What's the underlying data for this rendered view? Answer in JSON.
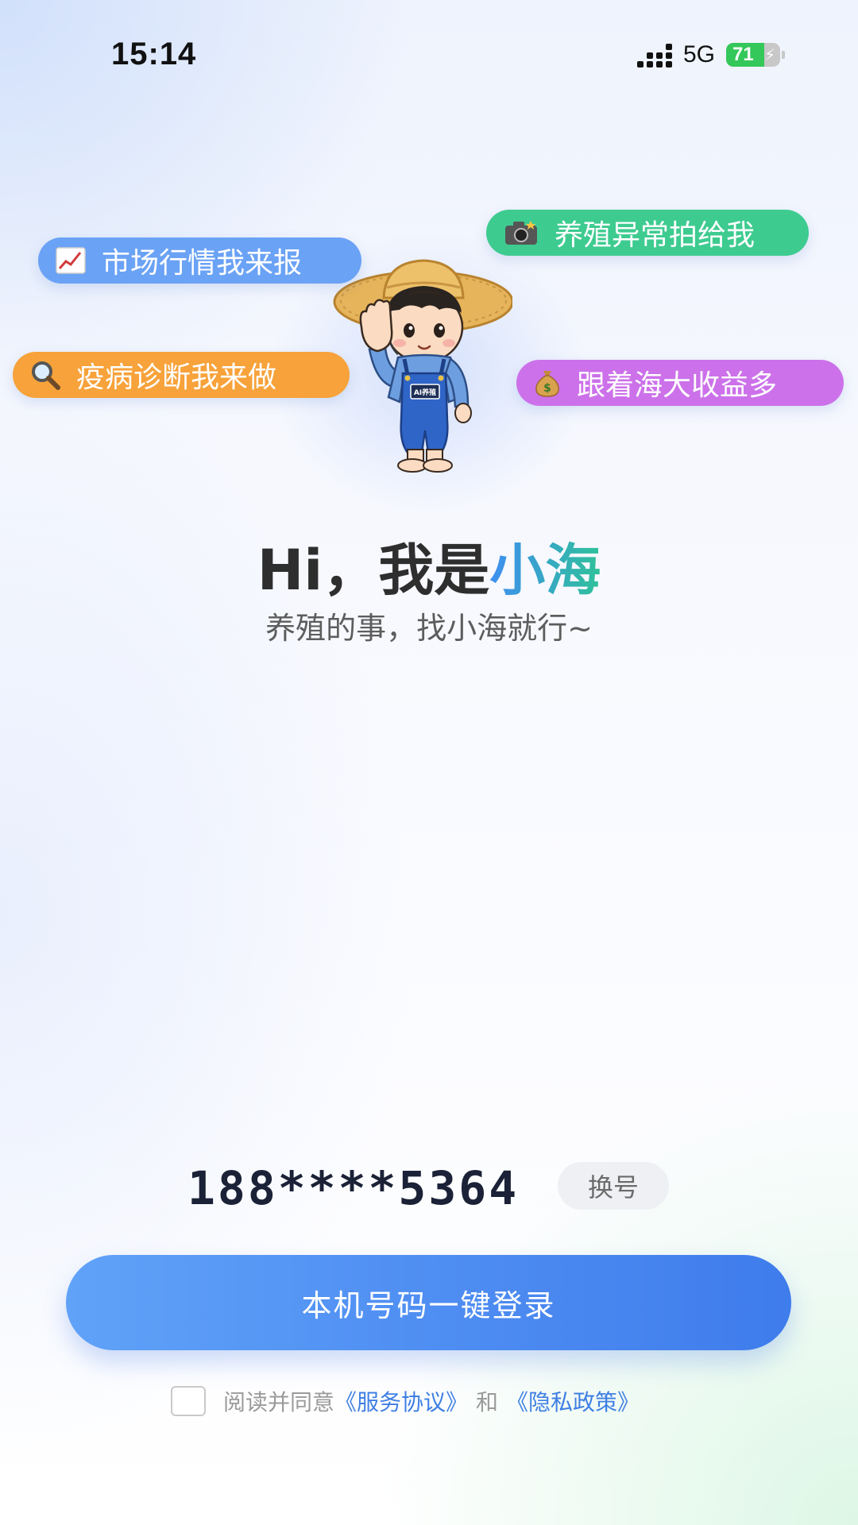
{
  "status_bar": {
    "time": "15:14",
    "network": "5G",
    "battery": "71",
    "battery_level": 0.71
  },
  "bubbles": [
    {
      "icon": "chart-up-icon",
      "label": "市场行情我来报",
      "color": "#6aa2f5"
    },
    {
      "icon": "camera-flash-icon",
      "label": "养殖异常拍给我",
      "color": "#3ecb90"
    },
    {
      "icon": "magnifier-icon",
      "label": "疫病诊断我来做",
      "color": "#f7a23a"
    },
    {
      "icon": "money-bag-icon",
      "label": "跟着海大收益多",
      "color": "#cc71ea"
    }
  ],
  "mascot": {
    "badge_text": "AI养殖"
  },
  "headline": {
    "greeting": "Hi，我是",
    "name": "小海"
  },
  "subtitle": "养殖的事，找小海就行~",
  "login": {
    "phone_masked": "188****5364",
    "switch_label": "换号",
    "button_label": "本机号码一键登录"
  },
  "agreement": {
    "prefix": "阅读并同意",
    "service_link": "《服务协议》",
    "conjunction": "和",
    "privacy_link": "《隐私政策》"
  },
  "colors": {
    "primary": "#4f8ef2",
    "accent_green": "#2fc19a"
  }
}
